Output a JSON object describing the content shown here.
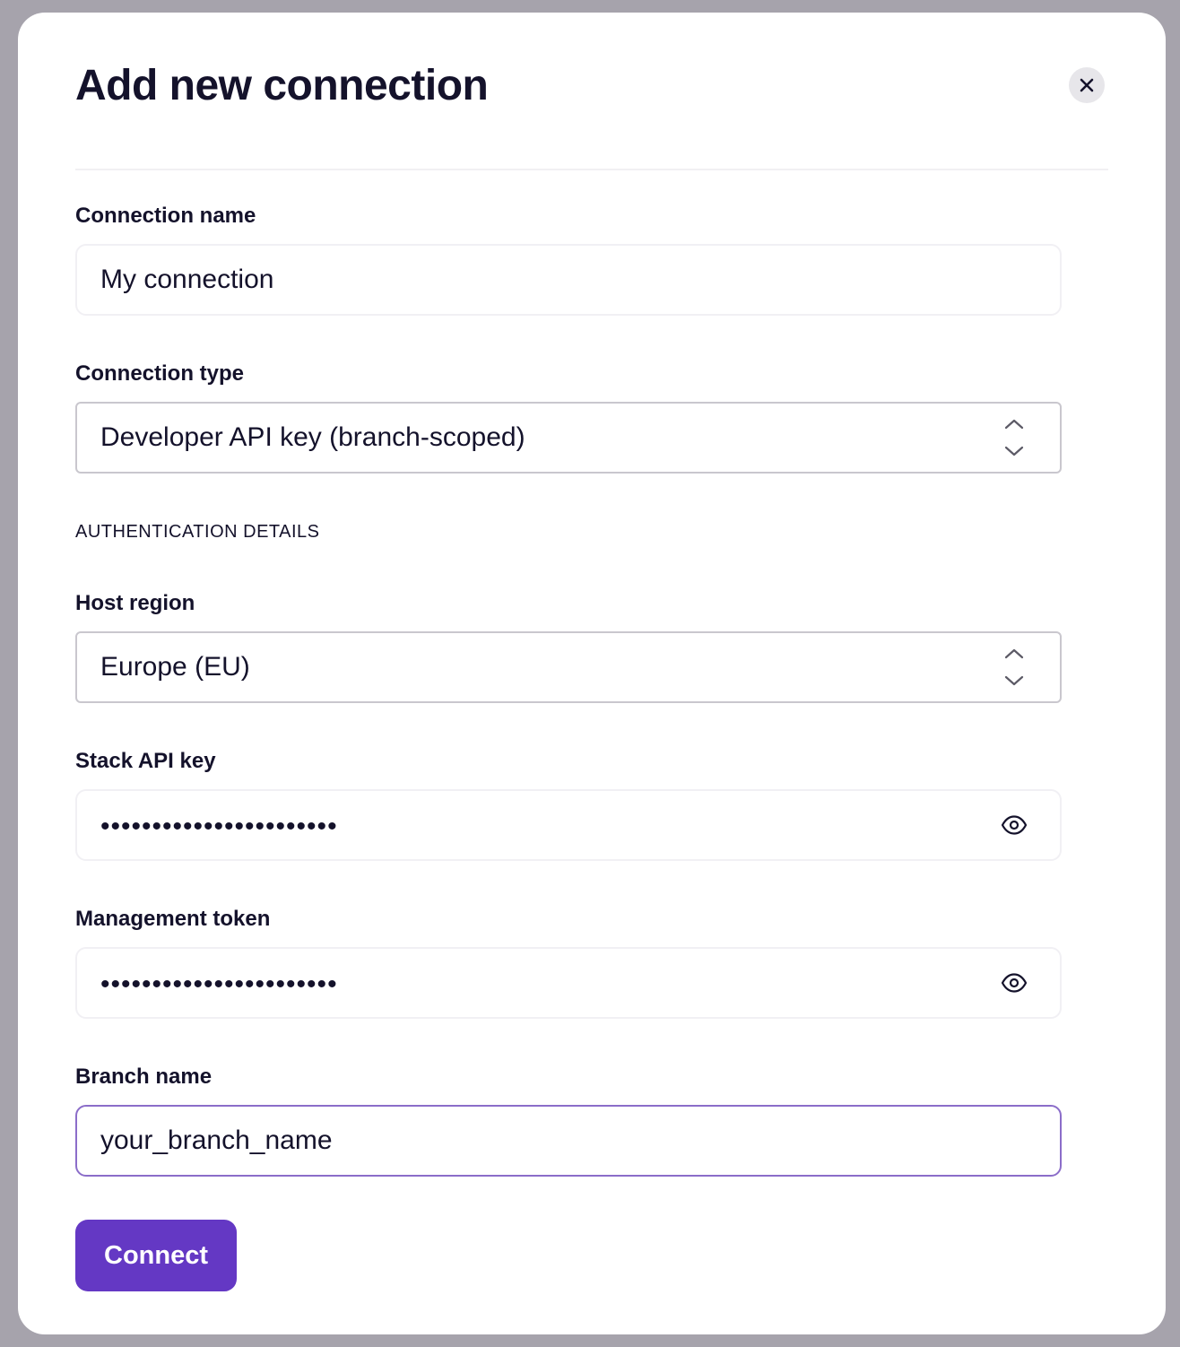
{
  "modal": {
    "title": "Add new connection",
    "close_icon": "close-icon"
  },
  "fields": {
    "connection_name": {
      "label": "Connection name",
      "value": "My connection"
    },
    "connection_type": {
      "label": "Connection type",
      "value": "Developer API key (branch-scoped)",
      "icon": "chevron-up-down-icon"
    },
    "section_heading": "AUTHENTICATION DETAILS",
    "host_region": {
      "label": "Host region",
      "value": "Europe (EU)",
      "icon": "chevron-up-down-icon"
    },
    "stack_api_key": {
      "label": "Stack API key",
      "value": "•••••••••••••••••••••••",
      "icon": "eye-icon"
    },
    "management_token": {
      "label": "Management token",
      "value": "•••••••••••••••••••••••",
      "icon": "eye-icon"
    },
    "branch_name": {
      "label": "Branch name",
      "value": "your_branch_name"
    }
  },
  "actions": {
    "connect_label": "Connect"
  },
  "colors": {
    "accent": "#6438c4",
    "focus_border": "#8b6dc9",
    "backdrop": "#a6a3ac",
    "text": "#14122b"
  }
}
